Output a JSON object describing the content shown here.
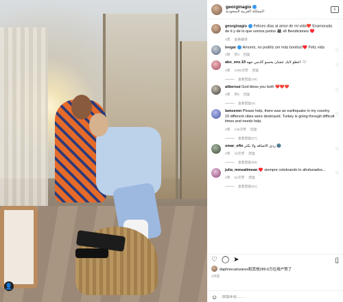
{
  "header": {
    "username": "georginagio",
    "subtitle": "المملكة العربية السعودية",
    "save_icon": "download-icon"
  },
  "post": {
    "username": "georginagio",
    "caption": "Felices días al amor de mi vida❤️ Enamorada de ti y de lo que somos juntos 👨‍👩‍👧‍👦 x6 Bendiciones ♥️",
    "time": "4周"
  },
  "comments": [
    {
      "username": "ivvgar",
      "text": "Amores, no podéis ser más bonitos!♥️ Feliz vida",
      "time": "4周",
      "likes": "赞3",
      "reply": "回复",
      "replies": ""
    },
    {
      "username": "abo_ens.19",
      "text": "اعطو لايك عشان يحسو كادمي جهه 🤍",
      "time": "4周",
      "likes": "1490次赞",
      "reply": "回复",
      "replies": "查看回复(49)"
    },
    {
      "username": "alikeroui",
      "text": "God bless you both ❤️❤️❤️",
      "time": "4周",
      "likes": "赞6",
      "reply": "回复",
      "replies": "查看回复(9)"
    },
    {
      "username": "lamceren",
      "text": "Please help, there was an earthquake in my country. 10 different cities were destroyed. Turkey is going through difficult times and needs help.",
      "time": "4周",
      "likes": "145次赞",
      "reply": "回复",
      "replies": "查看回复(27)"
    },
    {
      "username": "omar_eftn",
      "text": "ردي الاضافة ولا بكثر 🌚",
      "time": "4周",
      "likes": "15次赞",
      "reply": "回复",
      "replies": "查看回复(59)"
    },
    {
      "username": "julia_mmsalimean",
      "text": "♥️ siempre celebrando lo afortunados...",
      "time": "4周",
      "likes": "51次赞",
      "reply": "回复",
      "replies": "查看回复(51)"
    }
  ],
  "footer": {
    "liked_by": "daphnecanizares和其他289.6万位用户赞了",
    "date": "4月前",
    "add_comment_placeholder": "添加评论……"
  }
}
